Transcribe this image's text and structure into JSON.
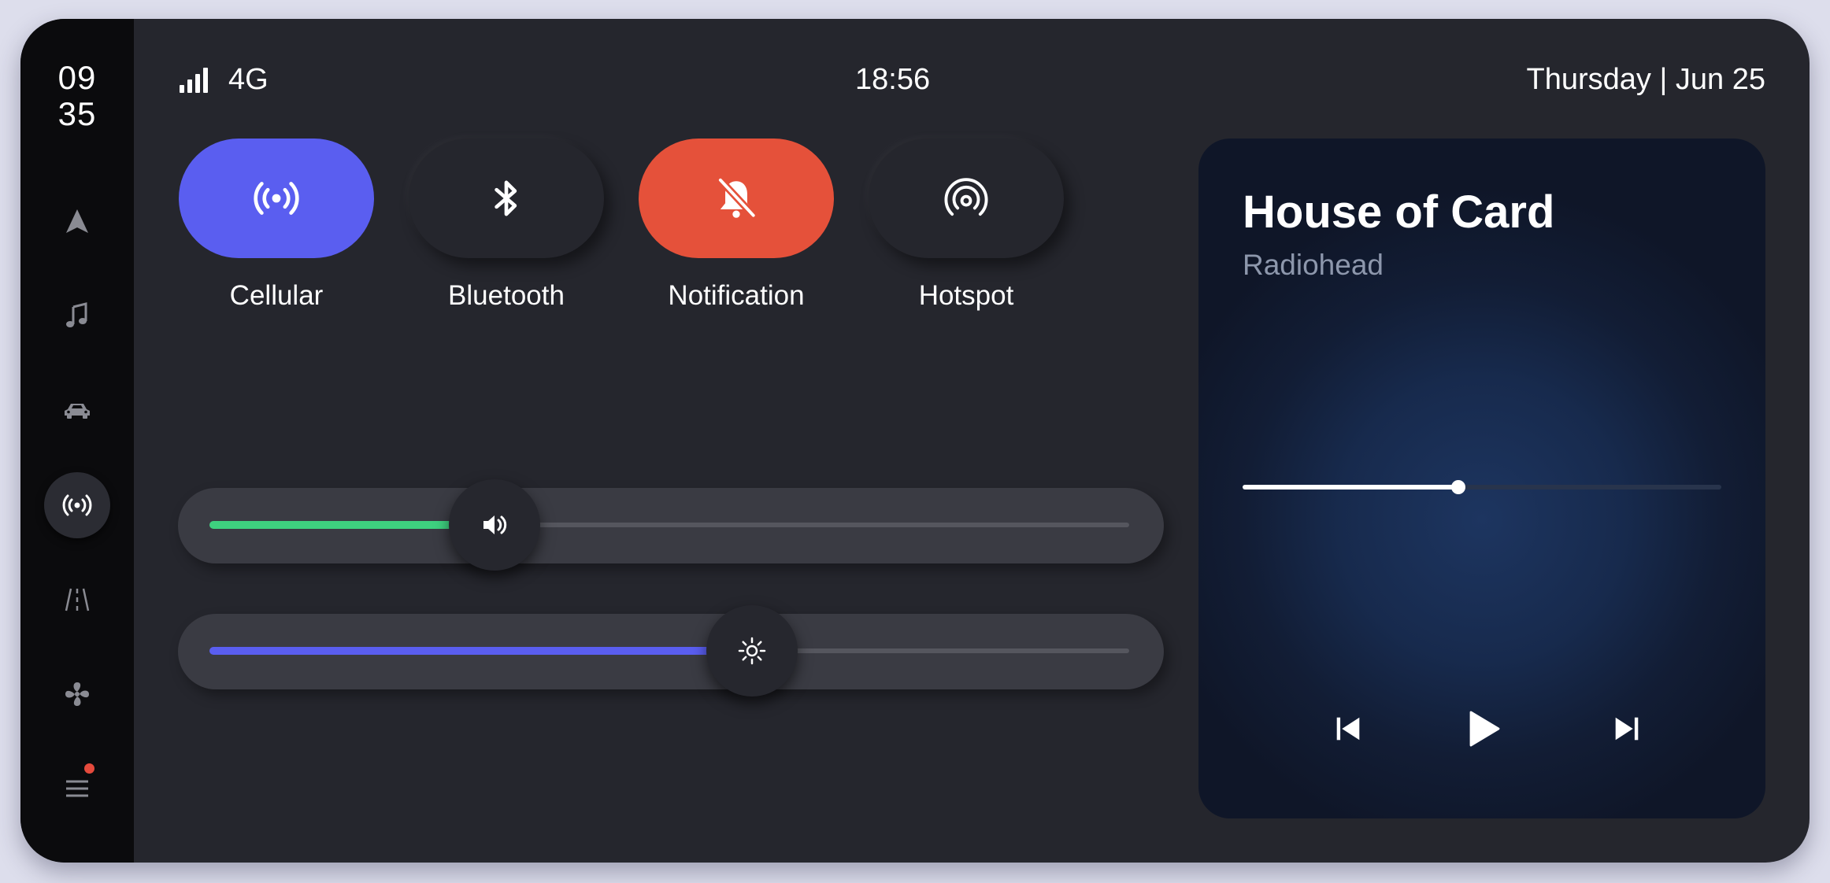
{
  "sidebar": {
    "clock_hour": "09",
    "clock_minute": "35",
    "items": [
      {
        "name": "navigation-icon"
      },
      {
        "name": "music-icon"
      },
      {
        "name": "car-icon"
      },
      {
        "name": "connectivity-icon",
        "active": true
      },
      {
        "name": "road-icon"
      },
      {
        "name": "fan-icon"
      },
      {
        "name": "menu-icon",
        "badge": true
      }
    ]
  },
  "status": {
    "network": "4G",
    "time": "18:56",
    "date": "Thursday | Jun 25"
  },
  "toggles": [
    {
      "label": "Cellular",
      "icon": "cellular-icon",
      "color": "#5a5ef0",
      "on": true
    },
    {
      "label": "Bluetooth",
      "icon": "bluetooth-icon",
      "color": "#25262d",
      "on": false
    },
    {
      "label": "Notification",
      "icon": "bell-off-icon",
      "color": "#e5513a",
      "on": true
    },
    {
      "label": "Hotspot",
      "icon": "hotspot-icon",
      "color": "#25262d",
      "on": false
    }
  ],
  "sliders": {
    "volume": {
      "icon": "volume-icon",
      "level": 0.31,
      "color": "#3ed17f"
    },
    "brightness": {
      "icon": "brightness-icon",
      "level": 0.59,
      "color": "#5a5ef0"
    }
  },
  "player": {
    "title": "House of Card",
    "artist": "Radiohead",
    "progress": 0.45
  }
}
